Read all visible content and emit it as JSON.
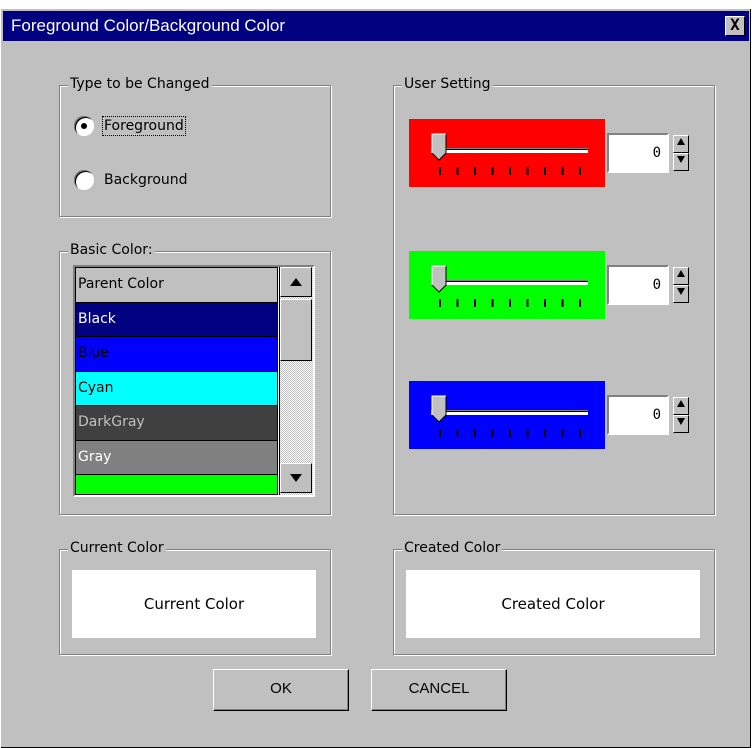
{
  "window": {
    "title": "Foreground Color/Background Color",
    "close_glyph": "X"
  },
  "type_group": {
    "legend": "Type to be Changed",
    "options": [
      {
        "label": "Foreground",
        "checked": true
      },
      {
        "label": "Background",
        "checked": false
      }
    ]
  },
  "basic_color": {
    "legend": "Basic Color:",
    "items": [
      {
        "label": "Parent Color",
        "bg": "#c0c0c0",
        "fg": "#000000"
      },
      {
        "label": "Black",
        "bg": "#000080",
        "fg": "#ffffff"
      },
      {
        "label": "Blue",
        "bg": "#0000ff",
        "fg": "#000000"
      },
      {
        "label": "Cyan",
        "bg": "#00ffff",
        "fg": "#000000"
      },
      {
        "label": "DarkGray",
        "bg": "#404040",
        "fg": "#c0c0c0"
      },
      {
        "label": "Gray",
        "bg": "#808080",
        "fg": "#ffffff"
      },
      {
        "label": "",
        "bg": "#00ff00",
        "fg": "#000000"
      }
    ]
  },
  "user_setting": {
    "legend": "User Setting",
    "channels": [
      {
        "name": "red",
        "color": "#ff0000",
        "value": "0"
      },
      {
        "name": "green",
        "color": "#00ff00",
        "value": "0"
      },
      {
        "name": "blue",
        "color": "#0000ff",
        "value": "0"
      }
    ]
  },
  "current_color": {
    "legend": "Current Color",
    "preview_text": "Current Color"
  },
  "created_color": {
    "legend": "Created Color",
    "preview_text": "Created Color"
  },
  "buttons": {
    "ok": "OK",
    "cancel": "CANCEL"
  }
}
